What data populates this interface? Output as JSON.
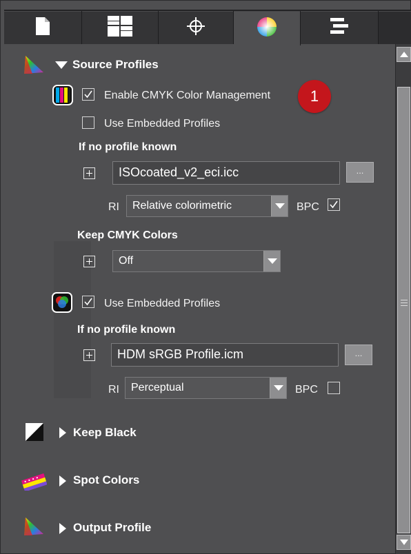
{
  "tabs": [
    {
      "icon": "document-icon"
    },
    {
      "icon": "layout-grid-icon"
    },
    {
      "icon": "crosshair-icon"
    },
    {
      "icon": "color-wheel-icon",
      "active": true
    },
    {
      "icon": "align-bars-icon"
    }
  ],
  "source_profiles": {
    "title": "Source Profiles",
    "enable_cmyk_label": "Enable CMYK Color Management",
    "enable_cmyk_checked": true,
    "cmyk_use_embedded_label": "Use Embedded Profiles",
    "cmyk_use_embedded_checked": false,
    "if_no_profile_cmyk": "If no profile known",
    "cmyk_profile_value": "ISOcoated_v2_eci.icc",
    "browse_label": "...",
    "ri_label": "RI",
    "cmyk_ri_value": "Relative colorimetric",
    "bpc_label": "BPC",
    "cmyk_bpc_checked": true,
    "keep_cmyk_title": "Keep CMYK Colors",
    "keep_cmyk_value": "Off",
    "rgb_use_embedded_label": "Use Embedded Profiles",
    "rgb_use_embedded_checked": true,
    "if_no_profile_rgb": "If no profile known",
    "rgb_profile_value": "HDM sRGB Profile.icm",
    "rgb_ri_value": "Perceptual",
    "rgb_bpc_checked": false
  },
  "callout": {
    "number": "1",
    "color": "#c4161c"
  },
  "sections": {
    "keep_black": "Keep Black",
    "spot_colors": "Spot Colors",
    "output_profile": "Output Profile"
  },
  "colors": {
    "panel_bg": "#4f4f51",
    "tab_bg": "#343436",
    "scrollbar": "#8e8e90"
  }
}
